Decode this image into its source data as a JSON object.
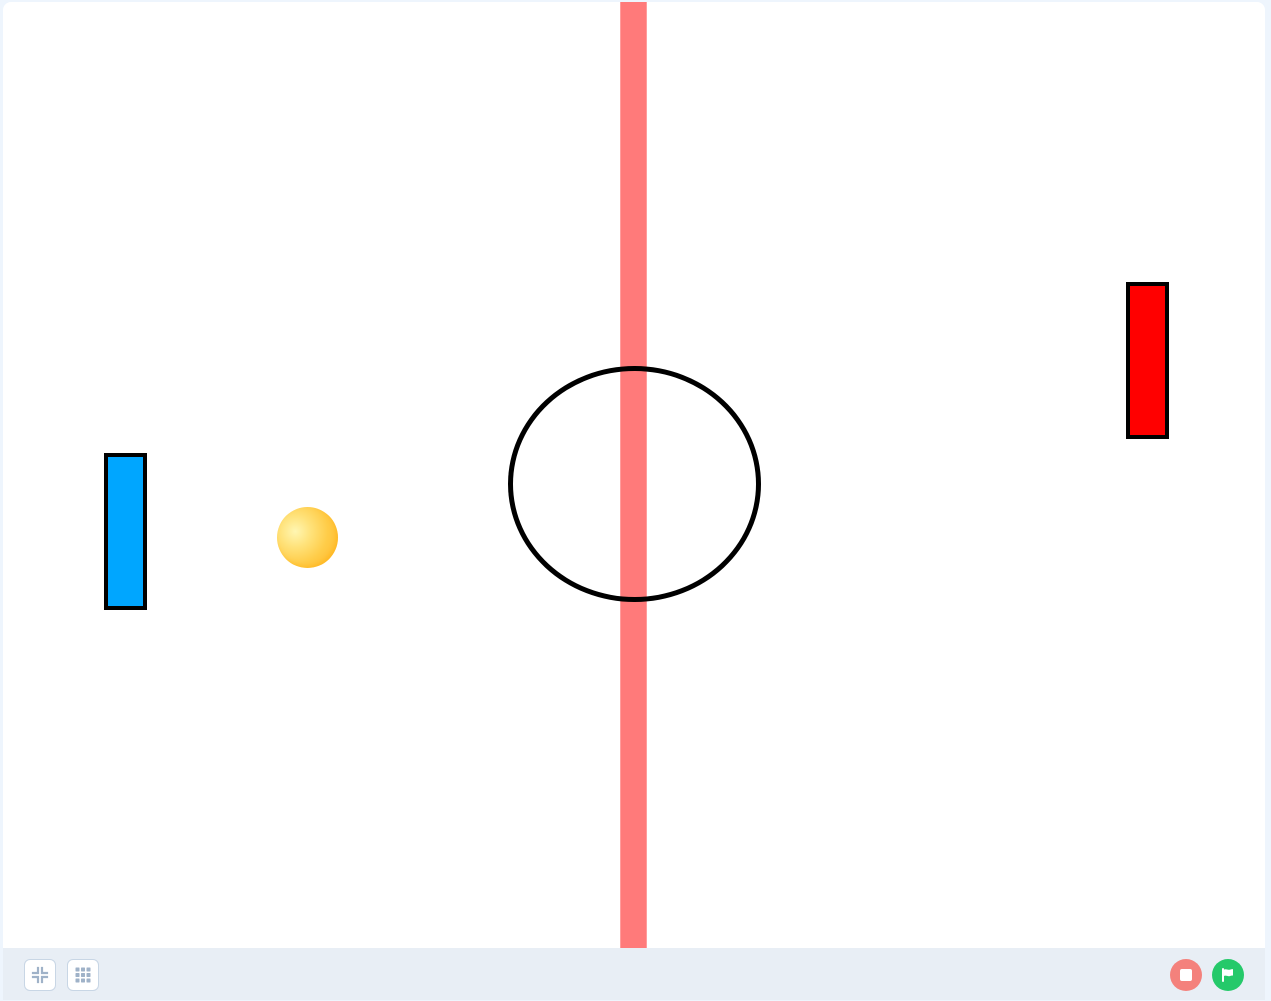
{
  "stage": {
    "background": "#ffffff"
  },
  "center_line": {
    "color": "#ff7a7a"
  },
  "center_circle": {
    "stroke": "#000000"
  },
  "paddles": {
    "left": {
      "color": "#00a6ff"
    },
    "right": {
      "color": "#ff0000"
    }
  },
  "ball": {
    "color": "#ffcc48"
  },
  "controls": {
    "shrink_icon": "shrink-icon",
    "grid_icon": "grid-icon",
    "stop_icon": "stop-icon",
    "go_icon": "green-flag-icon",
    "stop_color": "#f4817c",
    "go_color": "#25c96a"
  }
}
